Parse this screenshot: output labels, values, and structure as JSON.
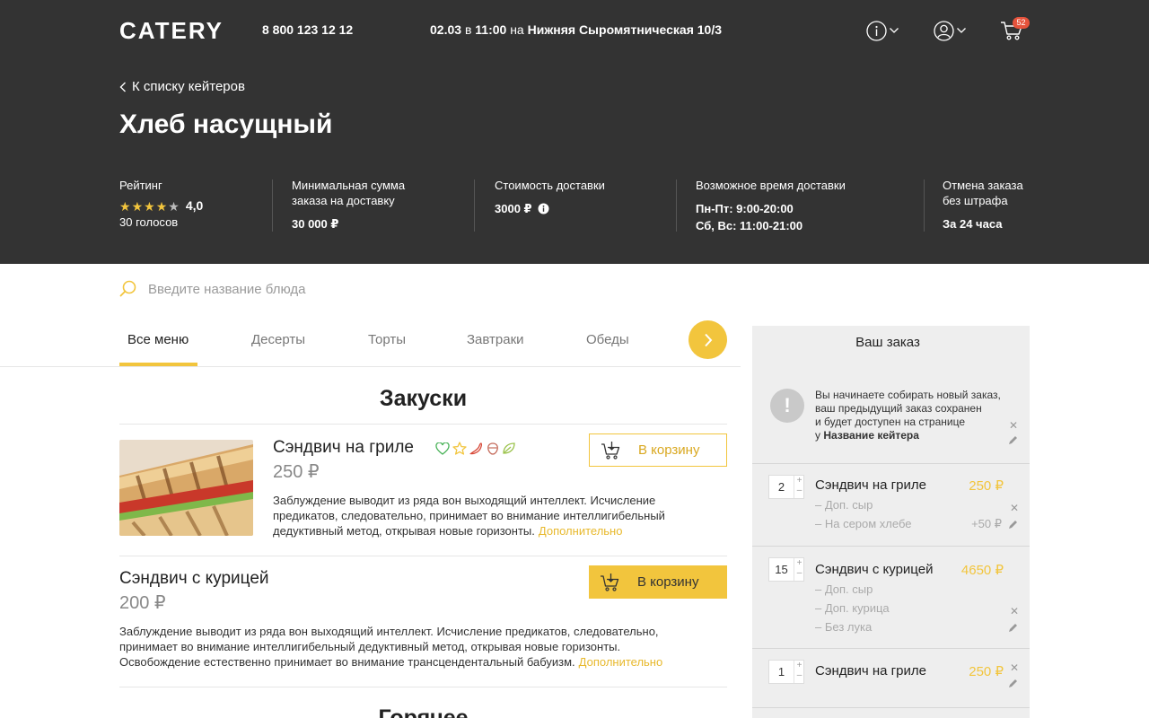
{
  "header": {
    "logo": "CATERY",
    "phone": "8 800 123 12 12",
    "delivery": {
      "date": "02.03",
      "in": "в",
      "time": "11:00",
      "at": "на",
      "address": "Нижняя Сыромятническая 10/3"
    },
    "cart_count": "52",
    "back_label": "К списку кейтеров",
    "title": "Хлеб насущный"
  },
  "stats": {
    "rating_label": "Рейтинг",
    "rating_value": "4,0",
    "rating_stars": 4,
    "rating_votes": "30 голосов",
    "min_label_1": "Минимальная сумма",
    "min_label_2": "заказа  на доставку",
    "min_value": "30 000 ₽",
    "cost_label": "Стоимость доставки",
    "cost_value": "3000 ₽",
    "time_label": "Возможное время доставки",
    "time_weekdays": "Пн-Пт: 9:00-20:00",
    "time_weekend": "Сб, Вс: 11:00-21:00",
    "cancel_label_1": "Отмена заказа",
    "cancel_label_2": "без штрафа",
    "cancel_value": "За 24 часа"
  },
  "search": {
    "placeholder": "Введите название блюда"
  },
  "tabs": [
    "Все меню",
    "Десерты",
    "Торты",
    "Завтраки",
    "Обеды"
  ],
  "menu": {
    "section_1": "Закуски",
    "section_2": "Горячее",
    "dishes": [
      {
        "name": "Сэндвич на гриле",
        "price": "250 ₽",
        "desc_1": "Заблуждение выводит из ряда вон выходящий интеллект. Исчисление",
        "desc_2": "предикатов, следовательно, принимает во внимание интеллигибельный",
        "desc_3": "дедуктивный метод, открывая новые горизонты.",
        "more": "Дополнительно",
        "button": "В корзину"
      },
      {
        "name": "Сэндвич с курицей",
        "price": "200 ₽",
        "desc_1": "Заблуждение выводит из ряда вон выходящий интеллект. Исчисление предикатов, следовательно,",
        "desc_2": "принимает во внимание интеллигибельный дедуктивный метод, открывая новые горизонты.",
        "desc_3": "Освобождение естественно принимает во внимание трансцендентальный бабуизм.",
        "more": "Дополнительно",
        "button": "В корзину"
      }
    ]
  },
  "order": {
    "title": "Ваш заказ",
    "note_1": "Вы начинаете собирать новый заказ,",
    "note_2": "ваш предыдущий заказ сохранен",
    "note_3": "и будет доступен на странице",
    "note_4_prefix": "у",
    "note_4_bold": "Название кейтера",
    "items": [
      {
        "qty": "2",
        "name": "Сэндвич на гриле",
        "price": "250 ₽",
        "opt_1": "– Доп. сыр",
        "opt_2": "– На сером хлебе",
        "opt_2_price": "+50 ₽"
      },
      {
        "qty": "15",
        "name": "Сэндвич с курицей",
        "price": "4650 ₽",
        "opt_1": "– Доп. сыр",
        "opt_2": "– Доп. курица",
        "opt_3": "– Без лука"
      },
      {
        "qty": "1",
        "name": "Сэндвич на гриле",
        "price": "250 ₽"
      }
    ]
  },
  "colors": {
    "accent": "#f2c53d",
    "hero_bg": "#333333",
    "panel_bg": "#eeeeee"
  }
}
